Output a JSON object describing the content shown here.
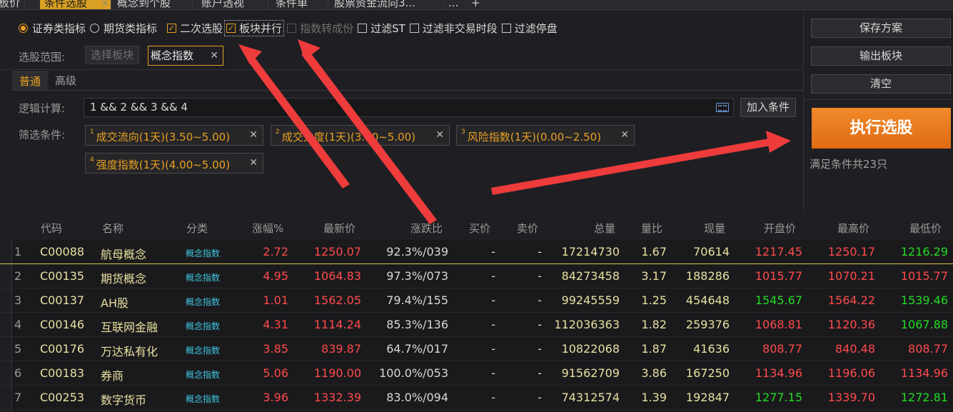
{
  "tabs": [
    {
      "label": "板价"
    },
    {
      "label": "条件选股"
    },
    {
      "label": "概念到个股"
    },
    {
      "label": "账户透视"
    },
    {
      "label": "条件单"
    },
    {
      "label": "股票资金流向3..."
    },
    {
      "label": "..."
    },
    {
      "label": "+"
    }
  ],
  "options": {
    "radio1": "证券类指标",
    "radio2": "期货类指标",
    "chk1": "二次选股",
    "chk2": "板块并行",
    "chk3": "指数转成份",
    "chk4": "过滤ST",
    "chk5": "过滤非交易时段",
    "chk6": "过滤停盘"
  },
  "scope": {
    "label": "选股范围:",
    "select_btn": "选择板块",
    "tag": "概念指数"
  },
  "subtabs": [
    "普通",
    "高级"
  ],
  "logic": {
    "label": "逻辑计算:",
    "value": "1 && 2 && 3 && 4",
    "add_btn": "加入条件"
  },
  "filter": {
    "label": "筛选条件:",
    "conditions": [
      {
        "num": "1",
        "text": "成交流向(1天)(3.50~5.00)"
      },
      {
        "num": "2",
        "text": "成交力度(1天)(3.50~5.00)"
      },
      {
        "num": "3",
        "text": "风险指数(1天)(0.00~2.50)"
      },
      {
        "num": "4",
        "text": "强度指数(1天)(4.00~5.00)"
      }
    ]
  },
  "right": {
    "save": "保存方案",
    "export": "输出板块",
    "clear": "清空",
    "execute": "执行选股",
    "result": "满足条件共23只"
  },
  "table": {
    "headers": [
      "代码",
      "名称",
      "分类",
      "涨幅%",
      "最新价",
      "涨跌比",
      "买价",
      "卖价",
      "总量",
      "量比",
      "现量",
      "开盘价",
      "最高价",
      "最低价"
    ],
    "rows": [
      {
        "n": "1",
        "code": "C00088",
        "name": "航母概念",
        "cat": "概念指数",
        "chg": "2.72",
        "price": "1250.07",
        "ratio": "92.3%/039",
        "buy": "-",
        "sell": "-",
        "vol": "17214730",
        "vr": "1.67",
        "cur": "70614",
        "open": "1217.45",
        "high": "1250.17",
        "low": "1216.29"
      },
      {
        "n": "2",
        "code": "C00135",
        "name": "期货概念",
        "cat": "概念指数",
        "chg": "4.95",
        "price": "1064.83",
        "ratio": "97.3%/073",
        "buy": "-",
        "sell": "-",
        "vol": "84273458",
        "vr": "3.17",
        "cur": "188286",
        "open": "1015.77",
        "high": "1070.21",
        "low": "1015.77"
      },
      {
        "n": "3",
        "code": "C00137",
        "name": "AH股",
        "cat": "概念指数",
        "chg": "1.01",
        "price": "1562.05",
        "ratio": "79.4%/155",
        "buy": "-",
        "sell": "-",
        "vol": "99245559",
        "vr": "1.25",
        "cur": "454648",
        "open": "1545.67",
        "high": "1564.22",
        "low": "1539.46"
      },
      {
        "n": "4",
        "code": "C00146",
        "name": "互联网金融",
        "cat": "概念指数",
        "chg": "4.31",
        "price": "1114.24",
        "ratio": "85.3%/136",
        "buy": "-",
        "sell": "-",
        "vol": "112036363",
        "vr": "1.82",
        "cur": "259376",
        "open": "1068.81",
        "high": "1120.36",
        "low": "1067.88"
      },
      {
        "n": "5",
        "code": "C00176",
        "name": "万达私有化",
        "cat": "概念指数",
        "chg": "3.85",
        "price": "839.87",
        "ratio": "64.7%/017",
        "buy": "-",
        "sell": "-",
        "vol": "10822068",
        "vr": "1.87",
        "cur": "41636",
        "open": "808.77",
        "high": "840.48",
        "low": "808.77"
      },
      {
        "n": "6",
        "code": "C00183",
        "name": "券商",
        "cat": "概念指数",
        "chg": "5.06",
        "price": "1190.00",
        "ratio": "100.0%/053",
        "buy": "-",
        "sell": "-",
        "vol": "91562709",
        "vr": "3.86",
        "cur": "167250",
        "open": "1134.96",
        "high": "1196.06",
        "low": "1134.96"
      },
      {
        "n": "7",
        "code": "C00253",
        "name": "数字货币",
        "cat": "概念指数",
        "chg": "3.96",
        "price": "1332.39",
        "ratio": "83.0%/094",
        "buy": "-",
        "sell": "-",
        "vol": "74312574",
        "vr": "1.39",
        "cur": "192847",
        "open": "1277.15",
        "high": "1339.70",
        "low": "1272.81"
      }
    ],
    "open_colors": [
      "red",
      "red",
      "green",
      "red",
      "red",
      "red",
      "green"
    ],
    "high_colors": [
      "red",
      "red",
      "red",
      "red",
      "red",
      "red",
      "red"
    ],
    "low_colors": [
      "green",
      "red",
      "green",
      "green",
      "red",
      "red",
      "green"
    ]
  }
}
